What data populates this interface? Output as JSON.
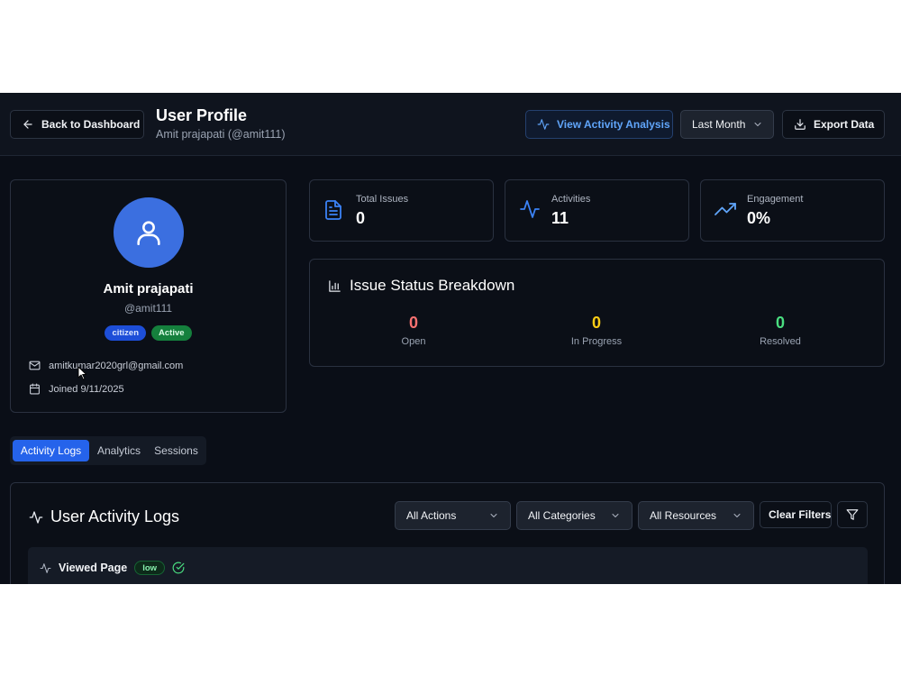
{
  "header": {
    "back_label": "Back to Dashboard",
    "title": "User Profile",
    "subtitle": "Amit prajapati (@amit111)",
    "activity_analysis_label": "View Activity Analysis",
    "period_selected": "Last Month",
    "export_label": "Export Data"
  },
  "profile": {
    "name": "Amit prajapati",
    "handle": "@amit111",
    "role_badge": "citizen",
    "status_badge": "Active",
    "email": "amitkumar2020grl@gmail.com",
    "joined": "Joined 9/11/2025"
  },
  "stats": [
    {
      "label": "Total Issues",
      "value": "0",
      "icon": "document-icon"
    },
    {
      "label": "Activities",
      "value": "11",
      "icon": "activity-icon"
    },
    {
      "label": "Engagement",
      "value": "0%",
      "icon": "trending-up-icon"
    }
  ],
  "breakdown": {
    "title": "Issue Status Breakdown",
    "items": [
      {
        "label": "Open",
        "value": "0",
        "color": "#f87171"
      },
      {
        "label": "In Progress",
        "value": "0",
        "color": "#facc15"
      },
      {
        "label": "Resolved",
        "value": "0",
        "color": "#4ade80"
      }
    ]
  },
  "tabs": [
    {
      "label": "Activity Logs",
      "active": true
    },
    {
      "label": "Analytics",
      "active": false
    },
    {
      "label": "Sessions",
      "active": false
    }
  ],
  "logs": {
    "title": "User Activity Logs",
    "filters": {
      "actions": "All Actions",
      "categories": "All Categories",
      "resources": "All Resources",
      "clear_label": "Clear Filters"
    },
    "entries": [
      {
        "title": "Viewed Page",
        "severity": "low"
      }
    ]
  },
  "colors": {
    "accent": "#2563eb",
    "avatar": "#3b6fe0",
    "background": "#0a0e17"
  }
}
